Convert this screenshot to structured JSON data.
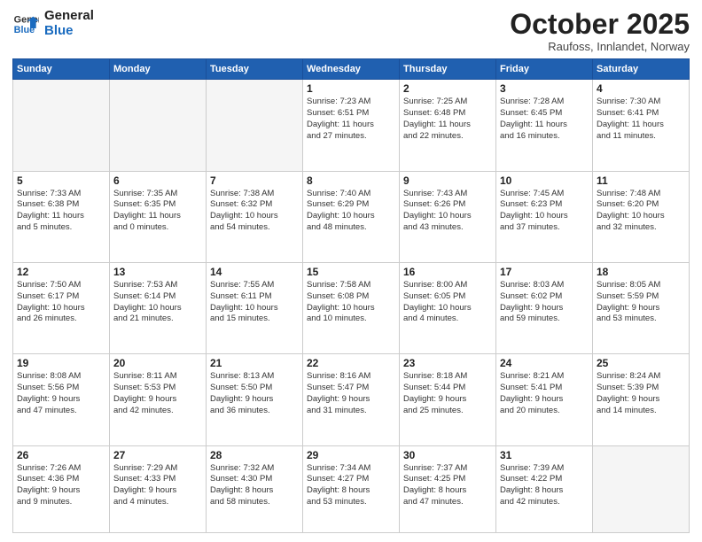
{
  "logo": {
    "line1": "General",
    "line2": "Blue"
  },
  "title": "October 2025",
  "subtitle": "Raufoss, Innlandet, Norway",
  "weekdays": [
    "Sunday",
    "Monday",
    "Tuesday",
    "Wednesday",
    "Thursday",
    "Friday",
    "Saturday"
  ],
  "weeks": [
    [
      {
        "day": "",
        "info": ""
      },
      {
        "day": "",
        "info": ""
      },
      {
        "day": "",
        "info": ""
      },
      {
        "day": "1",
        "info": "Sunrise: 7:23 AM\nSunset: 6:51 PM\nDaylight: 11 hours\nand 27 minutes."
      },
      {
        "day": "2",
        "info": "Sunrise: 7:25 AM\nSunset: 6:48 PM\nDaylight: 11 hours\nand 22 minutes."
      },
      {
        "day": "3",
        "info": "Sunrise: 7:28 AM\nSunset: 6:45 PM\nDaylight: 11 hours\nand 16 minutes."
      },
      {
        "day": "4",
        "info": "Sunrise: 7:30 AM\nSunset: 6:41 PM\nDaylight: 11 hours\nand 11 minutes."
      }
    ],
    [
      {
        "day": "5",
        "info": "Sunrise: 7:33 AM\nSunset: 6:38 PM\nDaylight: 11 hours\nand 5 minutes."
      },
      {
        "day": "6",
        "info": "Sunrise: 7:35 AM\nSunset: 6:35 PM\nDaylight: 11 hours\nand 0 minutes."
      },
      {
        "day": "7",
        "info": "Sunrise: 7:38 AM\nSunset: 6:32 PM\nDaylight: 10 hours\nand 54 minutes."
      },
      {
        "day": "8",
        "info": "Sunrise: 7:40 AM\nSunset: 6:29 PM\nDaylight: 10 hours\nand 48 minutes."
      },
      {
        "day": "9",
        "info": "Sunrise: 7:43 AM\nSunset: 6:26 PM\nDaylight: 10 hours\nand 43 minutes."
      },
      {
        "day": "10",
        "info": "Sunrise: 7:45 AM\nSunset: 6:23 PM\nDaylight: 10 hours\nand 37 minutes."
      },
      {
        "day": "11",
        "info": "Sunrise: 7:48 AM\nSunset: 6:20 PM\nDaylight: 10 hours\nand 32 minutes."
      }
    ],
    [
      {
        "day": "12",
        "info": "Sunrise: 7:50 AM\nSunset: 6:17 PM\nDaylight: 10 hours\nand 26 minutes."
      },
      {
        "day": "13",
        "info": "Sunrise: 7:53 AM\nSunset: 6:14 PM\nDaylight: 10 hours\nand 21 minutes."
      },
      {
        "day": "14",
        "info": "Sunrise: 7:55 AM\nSunset: 6:11 PM\nDaylight: 10 hours\nand 15 minutes."
      },
      {
        "day": "15",
        "info": "Sunrise: 7:58 AM\nSunset: 6:08 PM\nDaylight: 10 hours\nand 10 minutes."
      },
      {
        "day": "16",
        "info": "Sunrise: 8:00 AM\nSunset: 6:05 PM\nDaylight: 10 hours\nand 4 minutes."
      },
      {
        "day": "17",
        "info": "Sunrise: 8:03 AM\nSunset: 6:02 PM\nDaylight: 9 hours\nand 59 minutes."
      },
      {
        "day": "18",
        "info": "Sunrise: 8:05 AM\nSunset: 5:59 PM\nDaylight: 9 hours\nand 53 minutes."
      }
    ],
    [
      {
        "day": "19",
        "info": "Sunrise: 8:08 AM\nSunset: 5:56 PM\nDaylight: 9 hours\nand 47 minutes."
      },
      {
        "day": "20",
        "info": "Sunrise: 8:11 AM\nSunset: 5:53 PM\nDaylight: 9 hours\nand 42 minutes."
      },
      {
        "day": "21",
        "info": "Sunrise: 8:13 AM\nSunset: 5:50 PM\nDaylight: 9 hours\nand 36 minutes."
      },
      {
        "day": "22",
        "info": "Sunrise: 8:16 AM\nSunset: 5:47 PM\nDaylight: 9 hours\nand 31 minutes."
      },
      {
        "day": "23",
        "info": "Sunrise: 8:18 AM\nSunset: 5:44 PM\nDaylight: 9 hours\nand 25 minutes."
      },
      {
        "day": "24",
        "info": "Sunrise: 8:21 AM\nSunset: 5:41 PM\nDaylight: 9 hours\nand 20 minutes."
      },
      {
        "day": "25",
        "info": "Sunrise: 8:24 AM\nSunset: 5:39 PM\nDaylight: 9 hours\nand 14 minutes."
      }
    ],
    [
      {
        "day": "26",
        "info": "Sunrise: 7:26 AM\nSunset: 4:36 PM\nDaylight: 9 hours\nand 9 minutes."
      },
      {
        "day": "27",
        "info": "Sunrise: 7:29 AM\nSunset: 4:33 PM\nDaylight: 9 hours\nand 4 minutes."
      },
      {
        "day": "28",
        "info": "Sunrise: 7:32 AM\nSunset: 4:30 PM\nDaylight: 8 hours\nand 58 minutes."
      },
      {
        "day": "29",
        "info": "Sunrise: 7:34 AM\nSunset: 4:27 PM\nDaylight: 8 hours\nand 53 minutes."
      },
      {
        "day": "30",
        "info": "Sunrise: 7:37 AM\nSunset: 4:25 PM\nDaylight: 8 hours\nand 47 minutes."
      },
      {
        "day": "31",
        "info": "Sunrise: 7:39 AM\nSunset: 4:22 PM\nDaylight: 8 hours\nand 42 minutes."
      },
      {
        "day": "",
        "info": ""
      }
    ]
  ]
}
